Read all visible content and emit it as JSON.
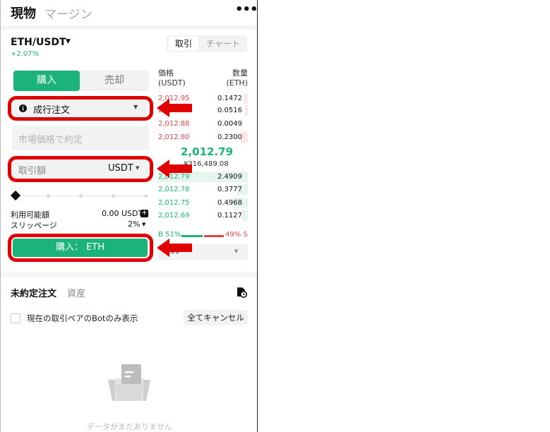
{
  "header": {
    "tab_spot": "現物",
    "tab_margin": "マージン",
    "more": "•••"
  },
  "pair": {
    "symbol": "ETH/USDT",
    "change": "+2.07%",
    "dropdown_icon": "caret-down-icon"
  },
  "view_tabs": {
    "trade": "取引",
    "chart": "チャート"
  },
  "order_form": {
    "buy_tab": "購入",
    "sell_tab": "売却",
    "order_type": "成行注文",
    "price_placeholder": "市場価格で約定",
    "amount_label": "取引額",
    "amount_unit": "USDT",
    "available_label": "利用可能額",
    "available_value": "0.00 USDT",
    "slippage_label": "スリッページ",
    "slippage_value": "2%",
    "submit": "購入： ETH",
    "slider_level": 0
  },
  "orderbook": {
    "price_header": "価格",
    "price_unit": "(USDT)",
    "qty_header": "数量",
    "qty_unit": "(ETH)",
    "asks": [
      {
        "price": "2,012.95",
        "qty": "0.1472"
      },
      {
        "price": "2,012.91",
        "qty": "0.0516"
      },
      {
        "price": "2,012.88",
        "qty": "0.0049"
      },
      {
        "price": "2,012.80",
        "qty": "0.2300"
      }
    ],
    "last_price": "2,012.79",
    "last_price_fiat": "¥316,489.08",
    "bids": [
      {
        "price": "2,012.79",
        "qty": "2.4909"
      },
      {
        "price": "2,012.78",
        "qty": "0.3777"
      },
      {
        "price": "2,012.75",
        "qty": "0.4968"
      },
      {
        "price": "2,012.69",
        "qty": "0.1127"
      }
    ],
    "buy_ratio_label": "B 51%",
    "sell_ratio_label": "49% S",
    "buy_ratio": 0.51,
    "depth_value": "0.01"
  },
  "orders": {
    "tab_open": "未約定注文",
    "tab_assets": "資産",
    "bot_only_label": "現在の取引ペアのBotのみ表示",
    "cancel_all": "全てキャンセル",
    "empty": "データがまだありません"
  },
  "colors": {
    "accent_green": "#1bb37a",
    "ask_red": "#e04545",
    "highlight_red": "#e00000"
  }
}
